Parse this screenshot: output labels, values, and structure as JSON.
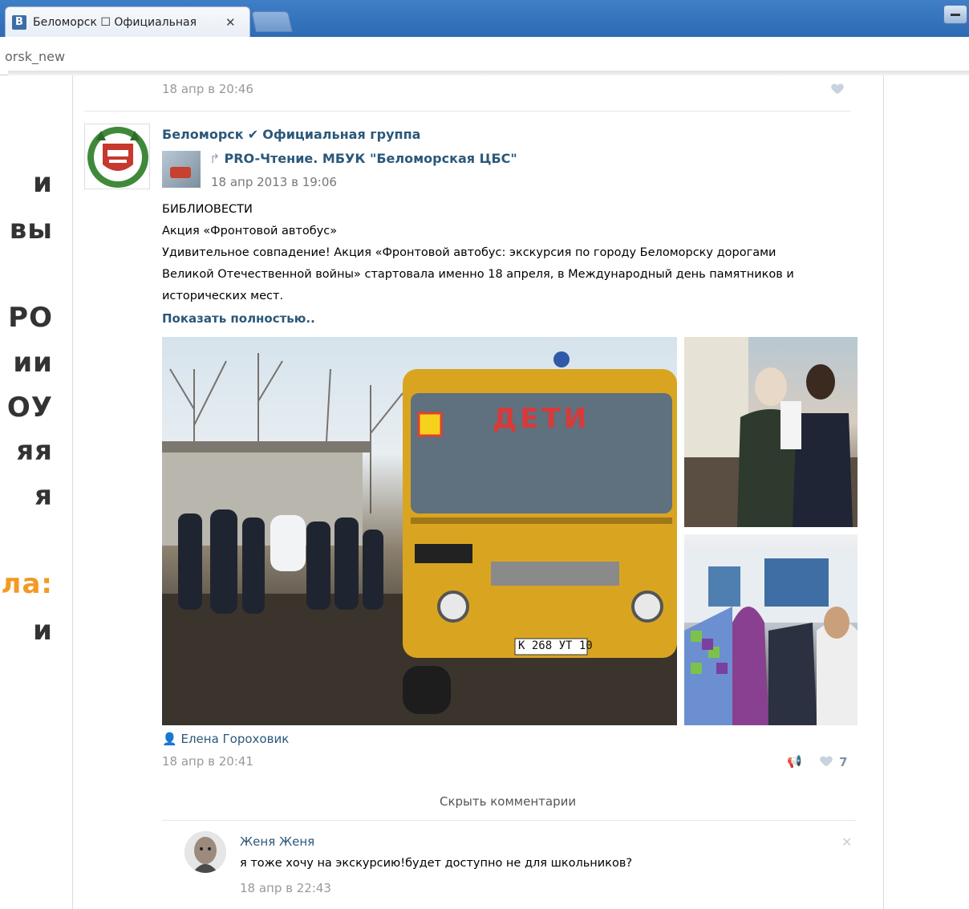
{
  "browser": {
    "tab_badge": "B",
    "tab_title": "Беломорск ☐ Официальная",
    "tab_close": "✕",
    "address": "orsk_new"
  },
  "slide_fragments": [
    {
      "text": "и",
      "color": "dark"
    },
    {
      "text": "вы",
      "color": "dark"
    },
    {
      "text": "РО",
      "color": "dark"
    },
    {
      "text": "ии",
      "color": "dark"
    },
    {
      "text": "ОУ",
      "color": "dark"
    },
    {
      "text": "яя",
      "color": "dark"
    },
    {
      "text": "я",
      "color": "dark"
    },
    {
      "text": "ла:",
      "color": "orange"
    },
    {
      "text": "и",
      "color": "dark"
    }
  ],
  "prev_post": {
    "date": "18 апр в 20:46"
  },
  "post": {
    "group_name": "Беломорск",
    "group_check": "✔",
    "group_suffix": "Официальная группа",
    "repost_icon": "↱",
    "repost_source": "PRO-Чтение. МБУК \"Беломорская ЦБС\"",
    "repost_date": "18 апр 2013 в 19:06",
    "line1": "БИБЛИОВЕСТИ",
    "line2": "Акция «Фронтовой автобус»",
    "line3": "Удивительное совпадение! Акция «Фронтовой автобус: экскурсия по городу Беломорску дорогами",
    "line4": "Великой Отечественной войны» стартовала именно 18 апреля, в Международный день памятников и",
    "line5": "исторических мест.",
    "show_more": "Показать полностью..",
    "bus_plate": "К 268 УТ 10",
    "bus_sign": "ДЕТИ",
    "author": "Елена Гороховик",
    "date": "18 апр в 20:41",
    "likes": "7",
    "hide_comments": "Скрыть комментарии"
  },
  "comment": {
    "author": "Женя Женя",
    "text": "я тоже хочу на экскурсию!будет доступно не для школьников?",
    "date": "18 апр в 22:43",
    "close": "✕"
  },
  "colors": {
    "link": "#2b587a",
    "orange": "#f29a24",
    "browser": "#2d6bb4"
  }
}
